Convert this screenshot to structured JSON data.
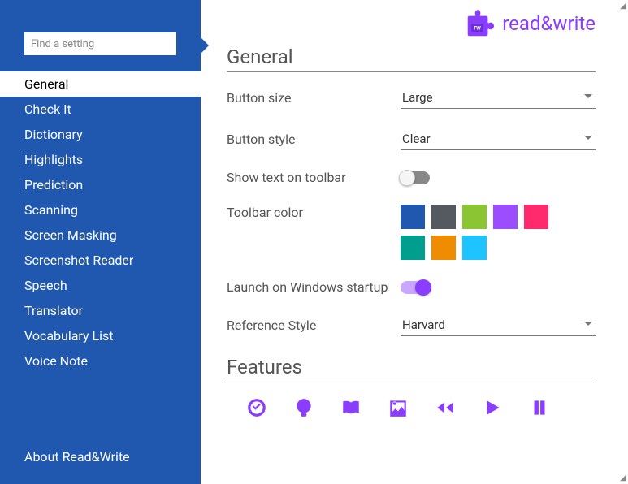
{
  "search": {
    "placeholder": "Find a setting"
  },
  "nav": {
    "items": [
      "General",
      "Check It",
      "Dictionary",
      "Highlights",
      "Prediction",
      "Scanning",
      "Screen Masking",
      "Screenshot Reader",
      "Speech",
      "Translator",
      "Vocabulary List",
      "Voice Note"
    ],
    "activeIndex": 0,
    "about": "About Read&Write"
  },
  "brand": {
    "text": "read&write",
    "badge": "rw"
  },
  "sections": {
    "general": {
      "title": "General",
      "button_size": {
        "label": "Button size",
        "value": "Large"
      },
      "button_style": {
        "label": "Button style",
        "value": "Clear"
      },
      "show_text": {
        "label": "Show text on toolbar",
        "on": false
      },
      "toolbar_color": {
        "label": "Toolbar color",
        "colors": [
          "#1f58ae",
          "#555a61",
          "#8bc534",
          "#9b4dff",
          "#ff2a6d",
          "#009e8e",
          "#f08c00",
          "#1ec4ff"
        ]
      },
      "launch": {
        "label": "Launch on Windows startup",
        "on": true
      },
      "reference": {
        "label": "Reference Style",
        "value": "Harvard"
      }
    },
    "features": {
      "title": "Features"
    }
  }
}
